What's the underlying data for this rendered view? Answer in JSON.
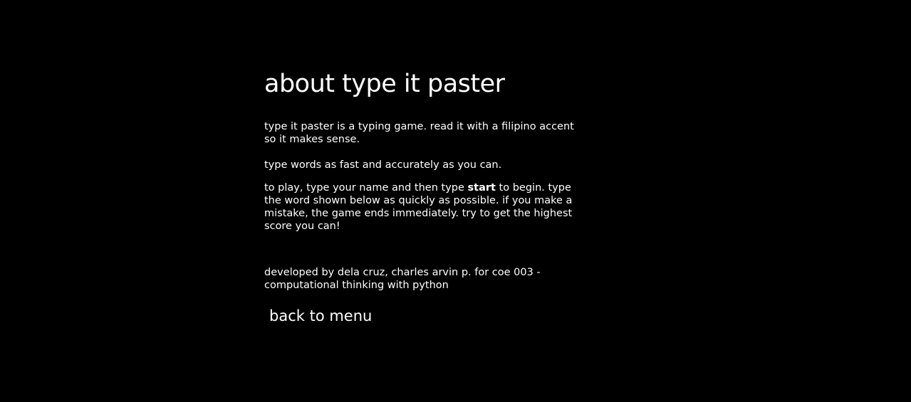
{
  "page": {
    "title": "about type it paster",
    "intro": "type it paster is a typing game. read it with a filipino accent so it makes sense.",
    "instruction": "type words as fast and accurately as you can.",
    "howto": {
      "before": "to play, type your name and then type ",
      "keyword": "start",
      "after": " to begin. type the word shown below as quickly as possible. if you make a mistake, the game ends immediately. try to get the highest score you can!"
    },
    "credits": "developed by dela cruz, charles arvin p. for coe 003 - computational thinking with python",
    "back_label": "back to menu"
  }
}
